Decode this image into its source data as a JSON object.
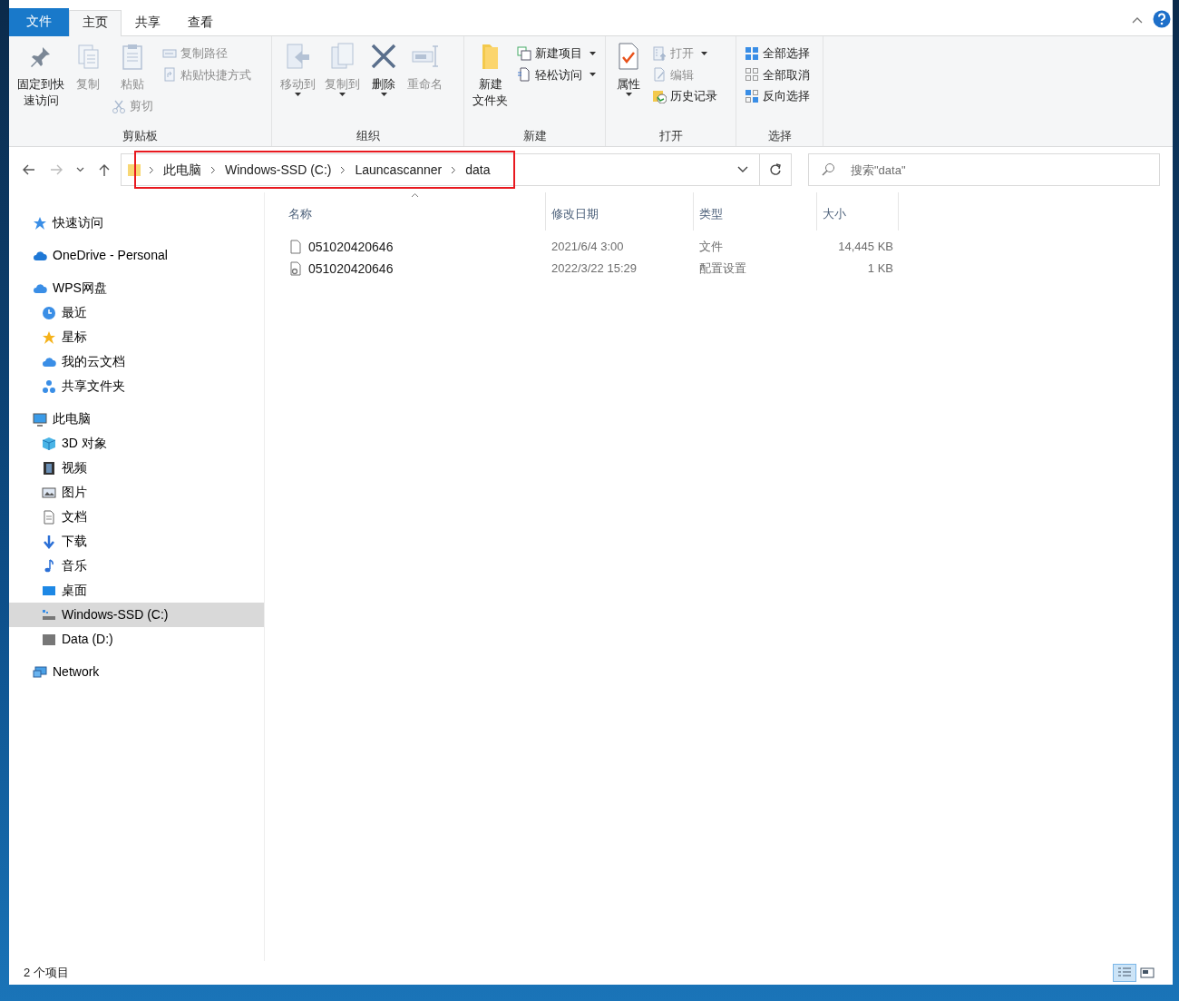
{
  "ribbon_tabs": [
    {
      "label": "文件",
      "kind": "file",
      "selected": false
    },
    {
      "label": "主页",
      "kind": "tab",
      "selected": true
    },
    {
      "label": "共享",
      "kind": "tab",
      "selected": false
    },
    {
      "label": "查看",
      "kind": "tab",
      "selected": false
    }
  ],
  "ribbon_groups": [
    {
      "label": "剪贴板",
      "columns": [
        [
          {
            "label": "固定到快速访问",
            "kind": "large",
            "disabled": false,
            "dropdown": false
          }
        ],
        [
          {
            "label": "复制",
            "kind": "large",
            "disabled": true,
            "dropdown": false
          }
        ],
        [
          {
            "label": "粘贴",
            "kind": "large",
            "disabled": true,
            "dropdown": false
          },
          {
            "label": "剪切",
            "kind": "small",
            "disabled": true,
            "dropdown": false
          }
        ],
        [
          {
            "label": "复制路径",
            "kind": "small",
            "disabled": true,
            "dropdown": false
          },
          {
            "label": "粘贴快捷方式",
            "kind": "small",
            "disabled": true,
            "dropdown": false
          }
        ]
      ]
    },
    {
      "label": "组织",
      "columns": [
        [
          {
            "label": "移动到",
            "kind": "large",
            "disabled": true,
            "dropdown": true
          }
        ],
        [
          {
            "label": "复制到",
            "kind": "large",
            "disabled": true,
            "dropdown": true
          }
        ],
        [
          {
            "label": "删除",
            "kind": "large",
            "disabled": false,
            "dropdown": true
          }
        ],
        [
          {
            "label": "重命名",
            "kind": "large",
            "disabled": true,
            "dropdown": false
          }
        ]
      ]
    },
    {
      "label": "新建",
      "columns": [
        [
          {
            "label": "新建文件夹",
            "kind": "large",
            "disabled": false,
            "dropdown": false
          }
        ],
        [
          {
            "label": "新建项目",
            "kind": "small",
            "disabled": false,
            "dropdown": true
          },
          {
            "label": "轻松访问",
            "kind": "small",
            "disabled": false,
            "dropdown": true
          }
        ]
      ]
    },
    {
      "label": "打开",
      "columns": [
        [
          {
            "label": "属性",
            "kind": "large",
            "disabled": false,
            "dropdown": true
          }
        ],
        [
          {
            "label": "打开",
            "kind": "small",
            "disabled": true,
            "dropdown": true
          },
          {
            "label": "编辑",
            "kind": "small",
            "disabled": true,
            "dropdown": false
          },
          {
            "label": "历史记录",
            "kind": "small",
            "disabled": false,
            "dropdown": false
          }
        ]
      ]
    },
    {
      "label": "选择",
      "columns": [
        [
          {
            "label": "全部选择",
            "kind": "small",
            "disabled": false,
            "dropdown": false
          },
          {
            "label": "全部取消",
            "kind": "small",
            "disabled": false,
            "dropdown": false
          },
          {
            "label": "反向选择",
            "kind": "small",
            "disabled": false,
            "dropdown": false
          }
        ]
      ]
    }
  ],
  "address_bar": {
    "highlighted": true,
    "path": [
      "此电脑",
      "Windows-SSD (C:)",
      "Launcascanner",
      "data"
    ]
  },
  "search": {
    "placeholder": "搜索\"data\""
  },
  "sidebar": {
    "items": [
      {
        "label": "快速访问",
        "selected": false
      },
      {
        "label": "OneDrive - Personal",
        "selected": false
      },
      {
        "label": "WPS网盘",
        "selected": false,
        "children": [
          {
            "label": "最近",
            "selected": false
          },
          {
            "label": "星标",
            "selected": false
          },
          {
            "label": "我的云文档",
            "selected": false
          },
          {
            "label": "共享文件夹",
            "selected": false
          }
        ]
      },
      {
        "label": "此电脑",
        "selected": false,
        "children": [
          {
            "label": "3D 对象",
            "selected": false
          },
          {
            "label": "视频",
            "selected": false
          },
          {
            "label": "图片",
            "selected": false
          },
          {
            "label": "文档",
            "selected": false
          },
          {
            "label": "下载",
            "selected": false
          },
          {
            "label": "音乐",
            "selected": false
          },
          {
            "label": "桌面",
            "selected": false
          },
          {
            "label": "Windows-SSD (C:)",
            "selected": true
          },
          {
            "label": "Data (D:)",
            "selected": false
          }
        ]
      },
      {
        "label": "Network",
        "selected": false
      }
    ]
  },
  "file_table": {
    "columns": [
      {
        "label": "名称",
        "sorted": true
      },
      {
        "label": "修改日期",
        "sorted": false
      },
      {
        "label": "类型",
        "sorted": false
      },
      {
        "label": "大小",
        "sorted": false
      }
    ],
    "rows": [
      {
        "kind": "file",
        "name": "051020420646",
        "modified": "2021/6/4 3:00",
        "type": "文件",
        "size": "14,445 KB"
      },
      {
        "kind": "config",
        "name": "051020420646",
        "modified": "2022/3/22 15:29",
        "type": "配置设置",
        "size": "1 KB"
      }
    ]
  },
  "status_bar": {
    "item_count": "2 个项目",
    "views": [
      {
        "kind": "details",
        "selected": true
      },
      {
        "kind": "large-icons",
        "selected": false
      }
    ]
  }
}
